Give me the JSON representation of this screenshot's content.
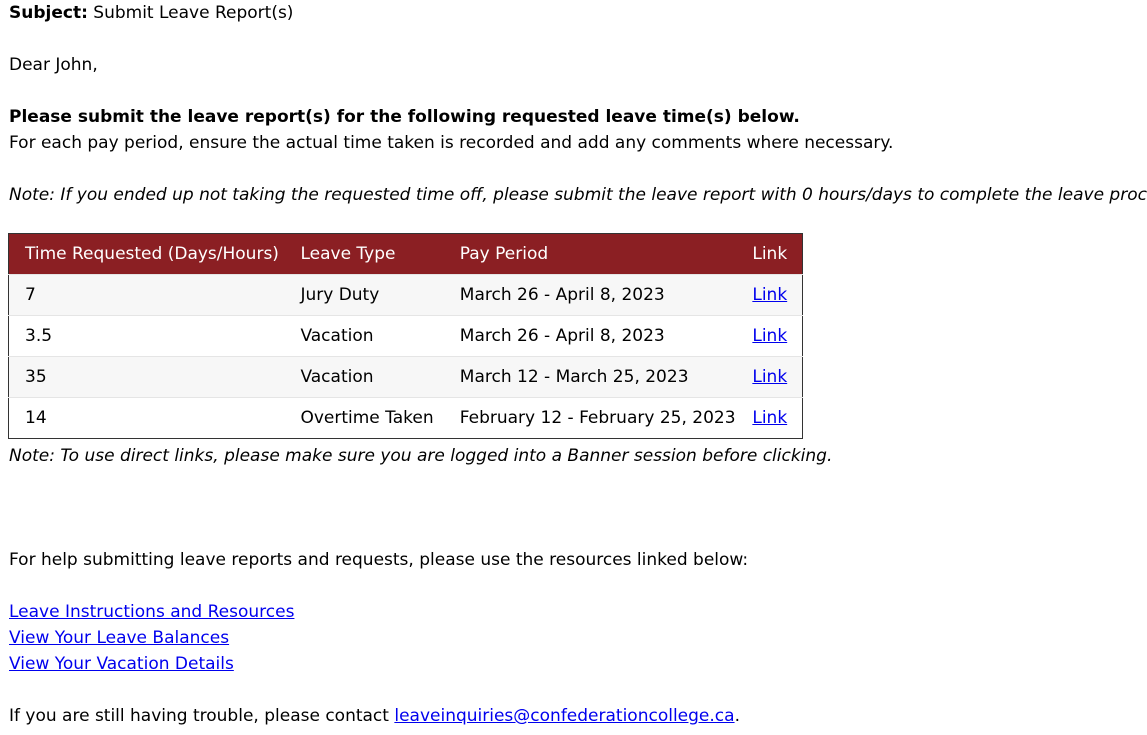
{
  "email": {
    "subject_label": "Subject:",
    "subject_text": " Submit Leave Report(s)",
    "greeting": "Dear John,",
    "intro_bold": "Please submit the leave report(s) for the following requested leave time(s) below.",
    "intro_text": "For each pay period, ensure the actual time taken is recorded and add any comments where necessary.",
    "note_top": "Note: If you ended up not taking the requested time off, please submit the leave report with 0 hours/days to complete the leave process.",
    "note_bottom": "Note: To use direct links, please make sure you are logged into a Banner session before clicking.",
    "help_text": "For help submitting leave reports and requests, please use the resources linked below:",
    "resources": [
      "Leave Instructions and Resources",
      "View Your Leave Balances",
      "View Your Vacation Details"
    ],
    "contact_prefix": "If you are still having trouble, please contact ",
    "contact_email": "leaveinquiries@confederationcollege.ca",
    "contact_suffix": "."
  },
  "table": {
    "headers": [
      "Time Requested (Days/Hours)",
      "Leave Type",
      "Pay Period",
      "Link"
    ],
    "rows": [
      {
        "time": "7",
        "type": "Jury Duty",
        "period": "March 26 - April 8, 2023",
        "link": "Link"
      },
      {
        "time": "3.5",
        "type": "Vacation",
        "period": "March 26 - April 8, 2023",
        "link": "Link"
      },
      {
        "time": "35",
        "type": "Vacation",
        "period": "March 12 - March 25, 2023",
        "link": "Link"
      },
      {
        "time": "14",
        "type": "Overtime Taken",
        "period": "February 12 - February 25, 2023",
        "link": "Link"
      }
    ]
  },
  "colors": {
    "header_bg": "#8b1f23",
    "link": "#0000ee"
  }
}
